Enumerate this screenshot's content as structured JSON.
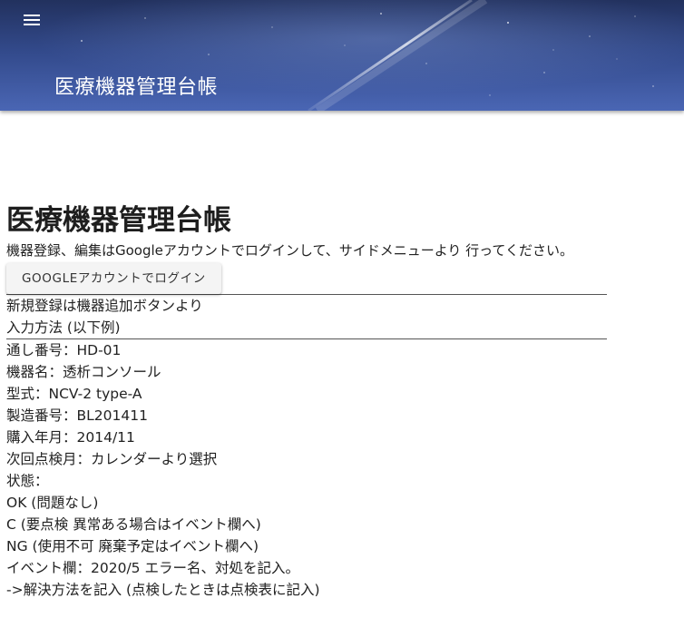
{
  "header": {
    "title": "医療機器管理台帳",
    "menu_icon": "hamburger-menu-icon",
    "banner": "night-sky-background"
  },
  "main": {
    "heading": "医療機器管理台帳",
    "intro": "機器登録、編集はGoogleアカウントでログインして、サイドメニューより 行ってください。",
    "login_button": "GOOGLEアカウントでログイン",
    "new_registration_note": "新規登録は機器追加ボタンより",
    "input_method_heading": "入力方法 (以下例)",
    "example_lines": [
      "通し番号：HD-01",
      "機器名：透析コンソール",
      "型式：NCV-2 type-A",
      "製造番号：BL201411",
      "購入年月：2014/11",
      "次回点検月：カレンダーより選択",
      "状態：",
      "OK (問題なし)",
      "C (要点検 異常ある場合はイベント欄へ)",
      "NG (使用不可 廃棄予定はイベント欄へ)",
      "イベント欄：2020/5 エラー名、対処を記入。",
      "->解決方法を記入 (点検したときは点検表に記入)"
    ]
  }
}
